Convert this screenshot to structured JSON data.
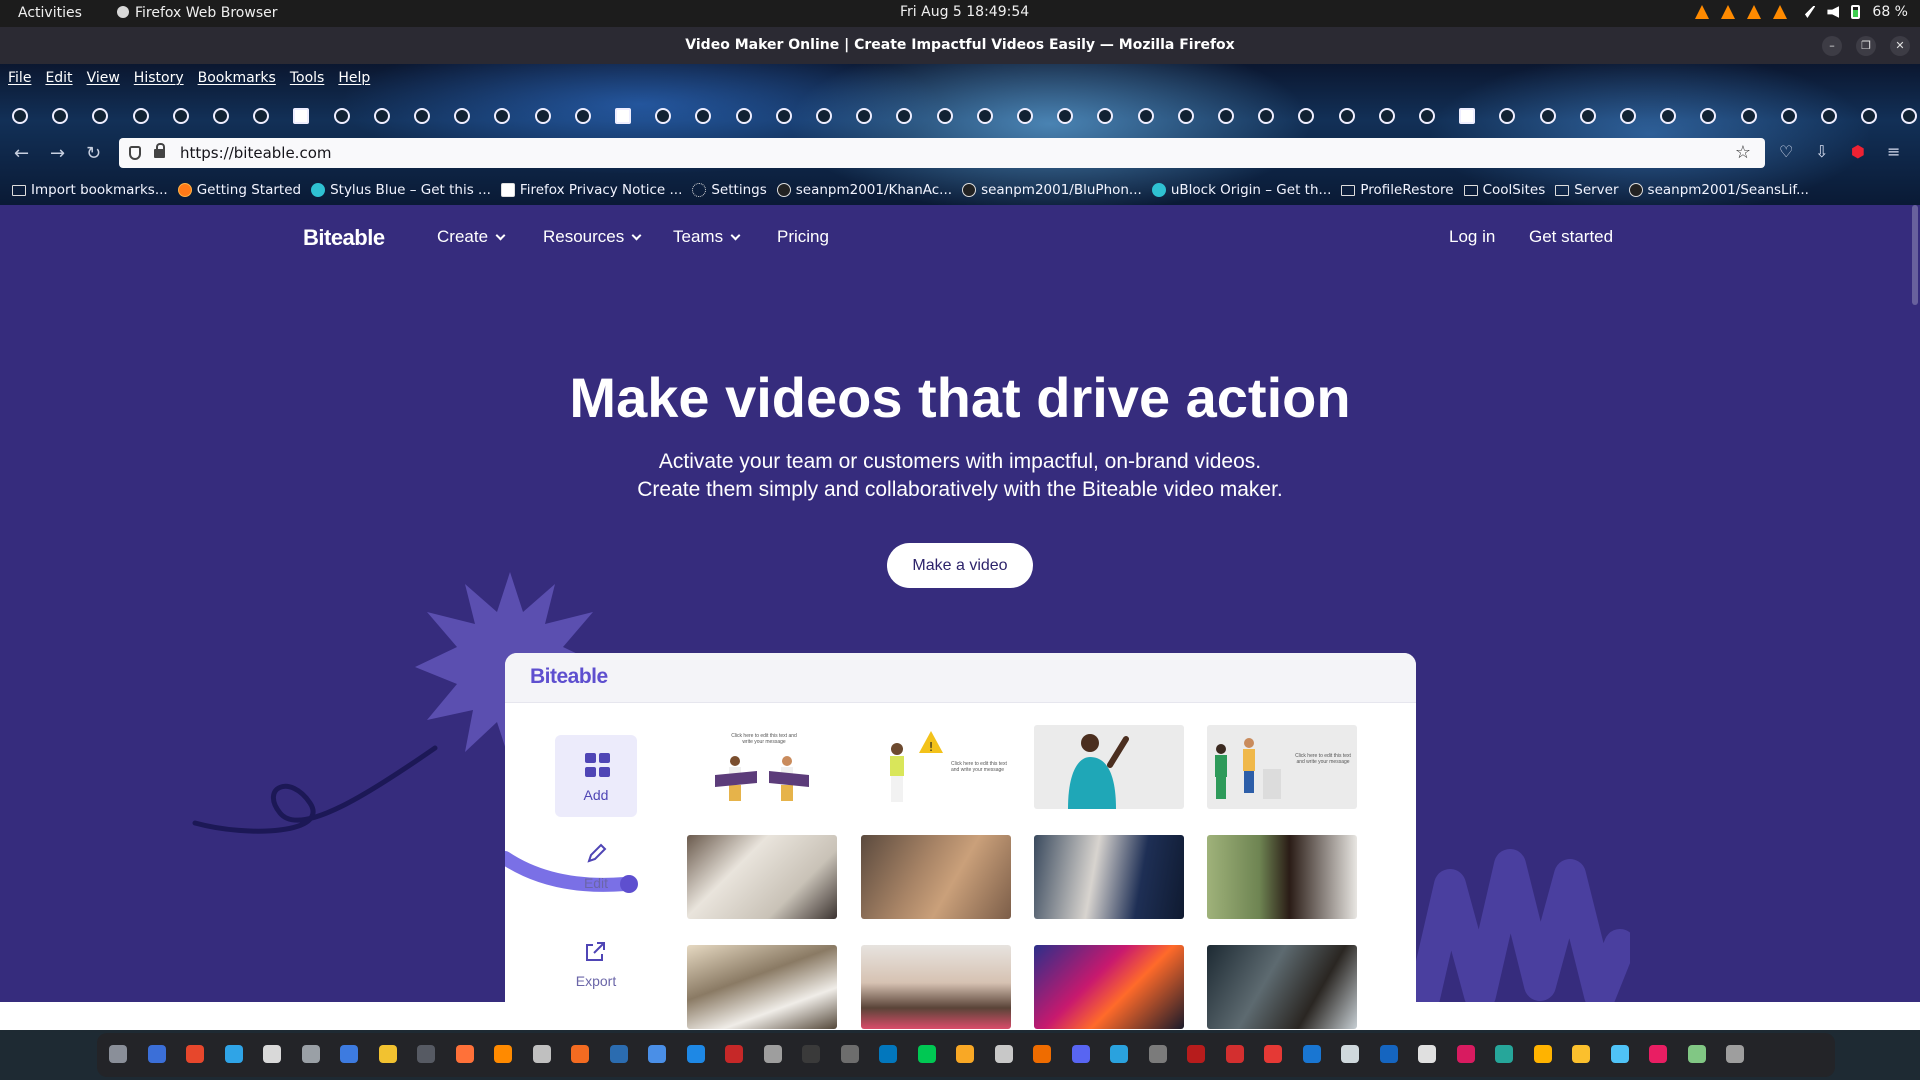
{
  "system_bar": {
    "activities": "Activities",
    "app_name": "Firefox Web Browser",
    "clock": "Fri Aug 5  18:49:54",
    "battery": "68 %"
  },
  "window": {
    "title": "Video Maker Online | Create Impactful Videos Easily — Mozilla Firefox"
  },
  "menubar": [
    "File",
    "Edit",
    "View",
    "History",
    "Bookmarks",
    "Tools",
    "Help"
  ],
  "address_bar": {
    "url": "https://biteable.com"
  },
  "bookmarks": [
    {
      "label": "Import bookmarks...",
      "icon": "import-icon"
    },
    {
      "label": "Getting Started",
      "icon": "firefox-icon"
    },
    {
      "label": "Stylus Blue – Get this ...",
      "icon": "stylus-icon"
    },
    {
      "label": "Firefox Privacy Notice ...",
      "icon": "mozilla-icon"
    },
    {
      "label": "Settings",
      "icon": "gear-icon"
    },
    {
      "label": "seanpm2001/KhanAc...",
      "icon": "github-icon"
    },
    {
      "label": "seanpm2001/BluPhon...",
      "icon": "github-icon"
    },
    {
      "label": "uBlock Origin – Get th...",
      "icon": "ublock-icon"
    },
    {
      "label": "ProfileRestore",
      "icon": "folder-icon"
    },
    {
      "label": "CoolSites",
      "icon": "folder-icon"
    },
    {
      "label": "Server",
      "icon": "folder-icon"
    },
    {
      "label": "seanpm2001/SeansLif...",
      "icon": "github-icon"
    }
  ],
  "site": {
    "logo": "Biteable",
    "nav": {
      "create": "Create",
      "resources": "Resources",
      "teams": "Teams",
      "pricing": "Pricing",
      "login": "Log in",
      "get_started": "Get started"
    },
    "hero": {
      "title": "Make videos that drive action",
      "subtitle_line1": "Activate your team or customers with impactful, on-brand videos.",
      "subtitle_line2": "Create them simply and collaboratively with the Biteable video maker.",
      "cta": "Make a video"
    },
    "mockup": {
      "logo": "Biteable",
      "tools": {
        "add": "Add",
        "edit": "Edit",
        "export": "Export"
      },
      "thumb_captions": {
        "t1": "Click here to edit this text and write your message",
        "t2": "Click here to edit this text and write your message",
        "t4": "Click here to edit this text and write your message"
      }
    }
  },
  "colors": {
    "page_bg": "#362c7d",
    "brand_purple": "#5e4fcf",
    "accent_light": "#ecebfb"
  }
}
